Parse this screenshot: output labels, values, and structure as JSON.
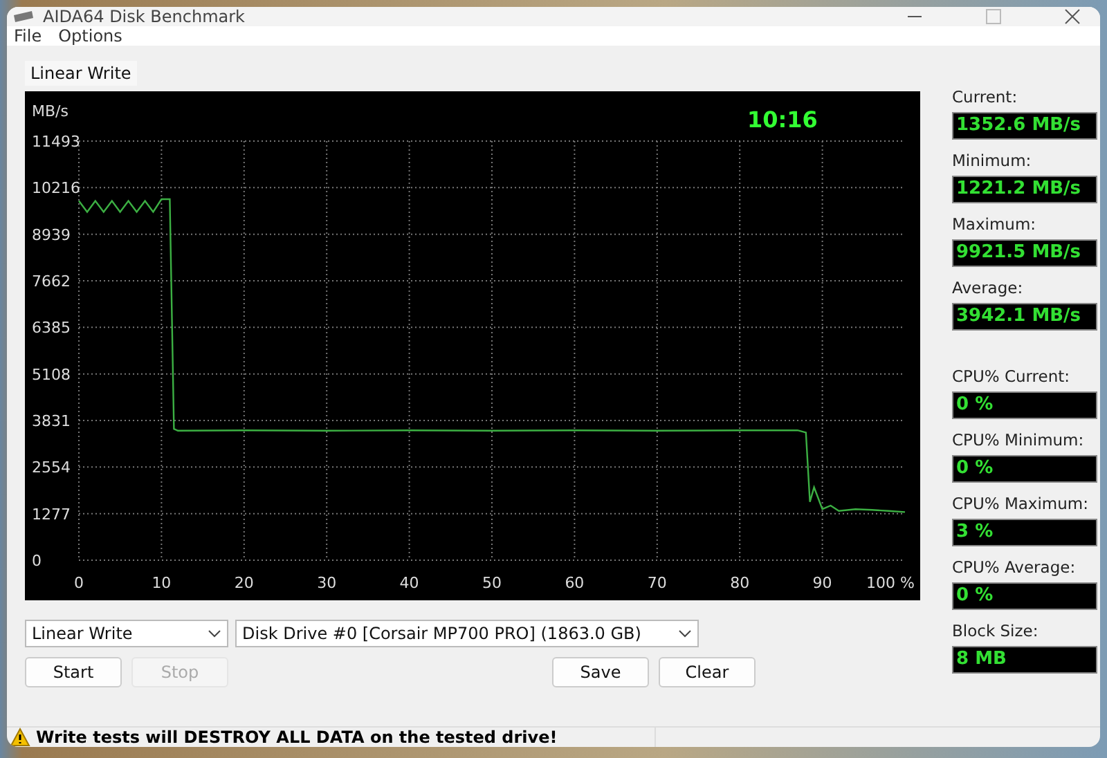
{
  "window": {
    "title": "AIDA64 Disk Benchmark"
  },
  "menu": [
    "File",
    "Options"
  ],
  "tabs": [
    {
      "label": "Linear Write",
      "selected": true
    }
  ],
  "chart": {
    "time": "10:16",
    "chart_data": {
      "type": "line",
      "grid": true,
      "ylabel": "MB/s",
      "xlim": [
        0,
        100
      ],
      "ylim": [
        0,
        11493
      ],
      "xticks": [
        0,
        10,
        20,
        30,
        40,
        50,
        60,
        70,
        80,
        90,
        {
          "value": 100,
          "label": "100 %"
        }
      ],
      "yticks": [
        0,
        1277,
        2554,
        3831,
        5108,
        6385,
        7662,
        8939,
        10216,
        11493
      ],
      "x": [
        0,
        1,
        2,
        3,
        4,
        5,
        6,
        7,
        8,
        9,
        10,
        11,
        11.5,
        12,
        20,
        30,
        40,
        50,
        60,
        70,
        80,
        87,
        88,
        88.5,
        89,
        90,
        91,
        92,
        94,
        96,
        98,
        100
      ],
      "series": [
        {
          "color": "#3cb043",
          "values": [
            9850,
            9550,
            9850,
            9550,
            9850,
            9550,
            9850,
            9550,
            9850,
            9550,
            9900,
            9900,
            3600,
            3550,
            3560,
            3550,
            3560,
            3550,
            3560,
            3550,
            3560,
            3560,
            3500,
            1600,
            2000,
            1400,
            1500,
            1350,
            1400,
            1380,
            1350,
            1320
          ]
        }
      ]
    }
  },
  "speed_stats": [
    {
      "label": "Current:",
      "value": "1352.6 MB/s"
    },
    {
      "label": "Minimum:",
      "value": "1221.2 MB/s"
    },
    {
      "label": "Maximum:",
      "value": "9921.5 MB/s"
    },
    {
      "label": "Average:",
      "value": "3942.1 MB/s"
    }
  ],
  "cpu_stats": [
    {
      "label": "CPU% Current:",
      "value": "0 %"
    },
    {
      "label": "CPU% Minimum:",
      "value": "0 %"
    },
    {
      "label": "CPU% Maximum:",
      "value": "3 %"
    },
    {
      "label": "CPU% Average:",
      "value": "0 %"
    }
  ],
  "block_size": {
    "label": "Block Size:",
    "value": "8 MB"
  },
  "test_select": {
    "value": "Linear Write"
  },
  "drive_select": {
    "value": "Disk Drive #0  [Corsair MP700 PRO]  (1863.0 GB)"
  },
  "run_buttons": [
    {
      "label": "Start",
      "disabled": false
    },
    {
      "label": "Stop",
      "disabled": true
    }
  ],
  "result_buttons": [
    {
      "label": "Save",
      "disabled": false
    },
    {
      "label": "Clear",
      "disabled": false
    }
  ],
  "status_bar": {
    "text": "Write tests will DESTROY ALL DATA on the tested drive!"
  }
}
